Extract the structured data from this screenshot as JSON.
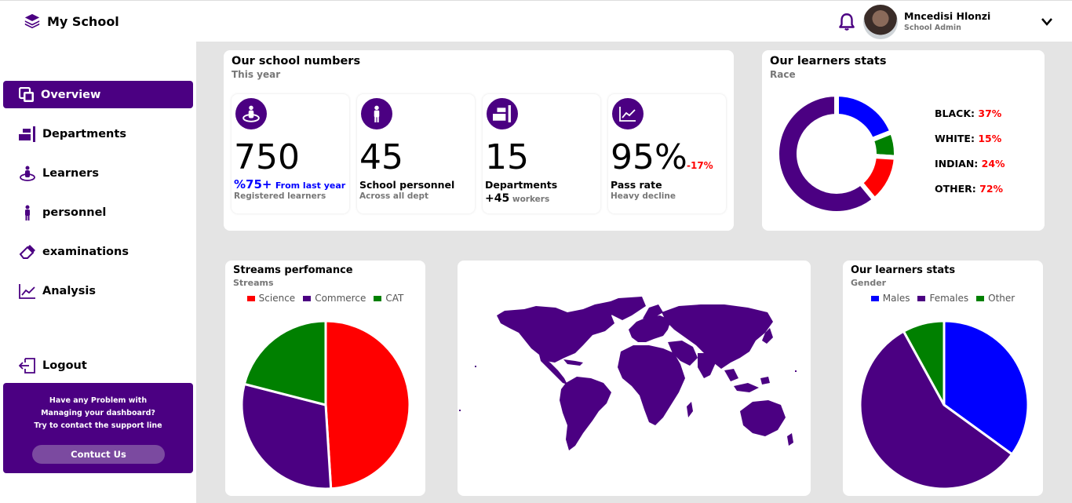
{
  "app": {
    "title": "My School"
  },
  "user": {
    "name": "Mncedisi Hlonzi",
    "role": "School Admin"
  },
  "nav": {
    "items": [
      {
        "label": "Overview"
      },
      {
        "label": "Departments"
      },
      {
        "label": "Learners"
      },
      {
        "label": "personnel"
      },
      {
        "label": "examinations"
      },
      {
        "label": "Analysis"
      }
    ],
    "logout": "Logout"
  },
  "help": {
    "line1": "Have any Problem with",
    "line2": "Managing your dashboard?",
    "line3": "Try to contact the support line",
    "button": "Contuct Us"
  },
  "numbers": {
    "title": "Our school numbers",
    "subtitle": "This year",
    "learners": {
      "value": "750",
      "delta": "%75+",
      "delta_note": "From last year",
      "label": "Registered learners"
    },
    "personnel": {
      "value": "45",
      "label": "School personnel",
      "sub": "Across all dept"
    },
    "departments": {
      "value": "15",
      "label": "Departments",
      "workers_count": "+45",
      "workers_label": "workers"
    },
    "pass": {
      "value": "95%",
      "change": "-17%",
      "label": "Pass rate",
      "note": "Heavy decline"
    }
  },
  "race": {
    "title": "Our learners stats",
    "subtitle": "Race",
    "rows": [
      {
        "label": "BLACK:",
        "value": "37%"
      },
      {
        "label": "WHITE:",
        "value": "15%"
      },
      {
        "label": "INDIAN:",
        "value": "24%"
      },
      {
        "label": "OTHER:",
        "value": "72%"
      }
    ]
  },
  "streams": {
    "title": "Streams perfomance",
    "subtitle": "Streams"
  },
  "gender": {
    "title": "Our learners stats",
    "subtitle": "Gender"
  },
  "colors": {
    "accent": "#4b0082",
    "red": "#ff0000",
    "blue": "#0000ff",
    "green": "#008000"
  },
  "chart_data": [
    {
      "type": "pie",
      "categories": [
        "BLACK",
        "WHITE",
        "INDIAN",
        "OTHER"
      ],
      "values": [
        19,
        7,
        13,
        61
      ],
      "colors": [
        "#0000ff",
        "#008000",
        "#ff0000",
        "#4b0082"
      ],
      "donut": true
    },
    {
      "type": "pie",
      "categories": [
        "Science",
        "Commerce",
        "CAT"
      ],
      "values": [
        49,
        30,
        21
      ],
      "colors": [
        "#ff0000",
        "#4b0082",
        "#008000"
      ],
      "legend": "top"
    },
    {
      "type": "pie",
      "categories": [
        "Males",
        "Females",
        "Other"
      ],
      "values": [
        35,
        57,
        8
      ],
      "colors": [
        "#0000ff",
        "#4b0082",
        "#008000"
      ],
      "legend": "top"
    }
  ]
}
